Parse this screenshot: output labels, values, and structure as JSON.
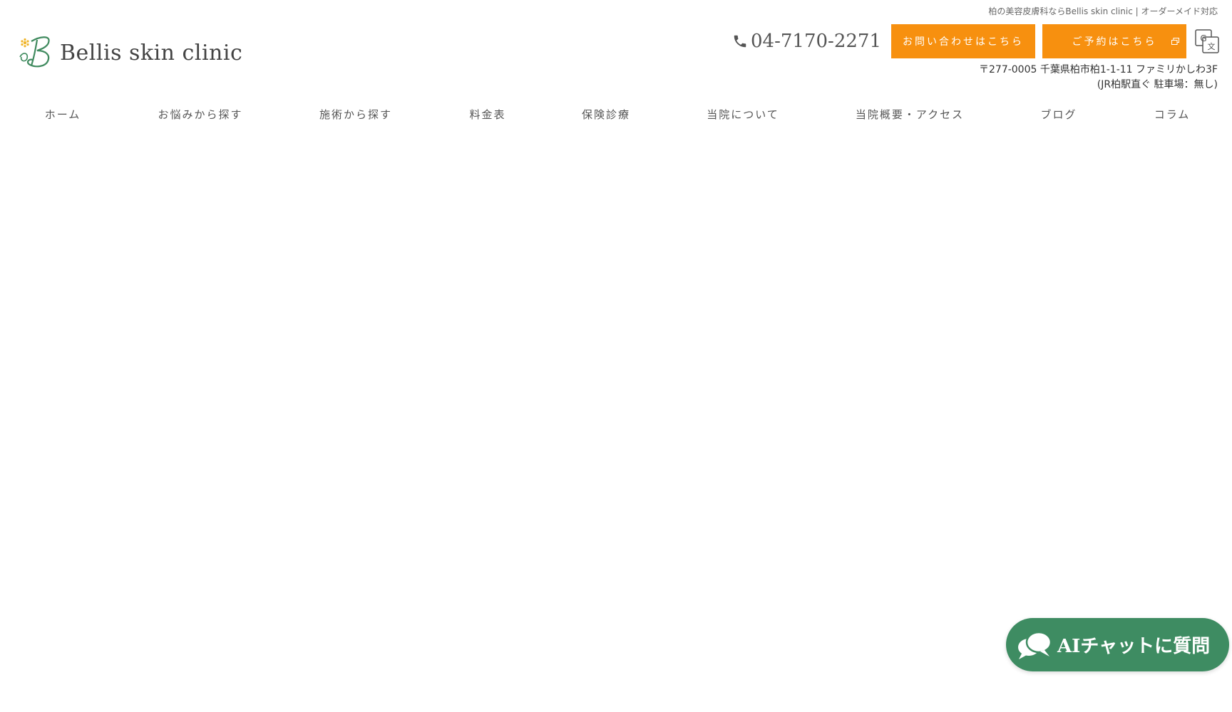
{
  "header": {
    "tagline": "柏の美容皮膚科ならBellis skin clinic | オーダーメイド対応",
    "logo_text": "Bellis skin clinic",
    "phone": "04-7170-2271",
    "contact_button": "お問い合わせはこちら",
    "reserve_button": "ご予約はこちら",
    "address_line1": "〒277-0005 千葉県柏市柏1-1-11 ファミリかしわ3F",
    "address_line2": "(JR柏駅直ぐ 駐車場：無し)"
  },
  "nav": {
    "items": [
      "ホーム",
      "お悩みから探す",
      "施術から探す",
      "料金表",
      "保険診療",
      "当院について",
      "当院概要・アクセス",
      "ブログ",
      "コラム"
    ]
  },
  "chat": {
    "label": "AIチャットに質問"
  },
  "colors": {
    "accent_orange": "#f7900f",
    "chat_green": "#3e8c62",
    "logo_green": "#3f8a5e",
    "logo_flower": "#f0b429"
  },
  "icons": {
    "phone": "phone-icon",
    "external": "external-link-icon",
    "translate": "google-translate-icon",
    "chat": "chat-bubble-icon"
  }
}
